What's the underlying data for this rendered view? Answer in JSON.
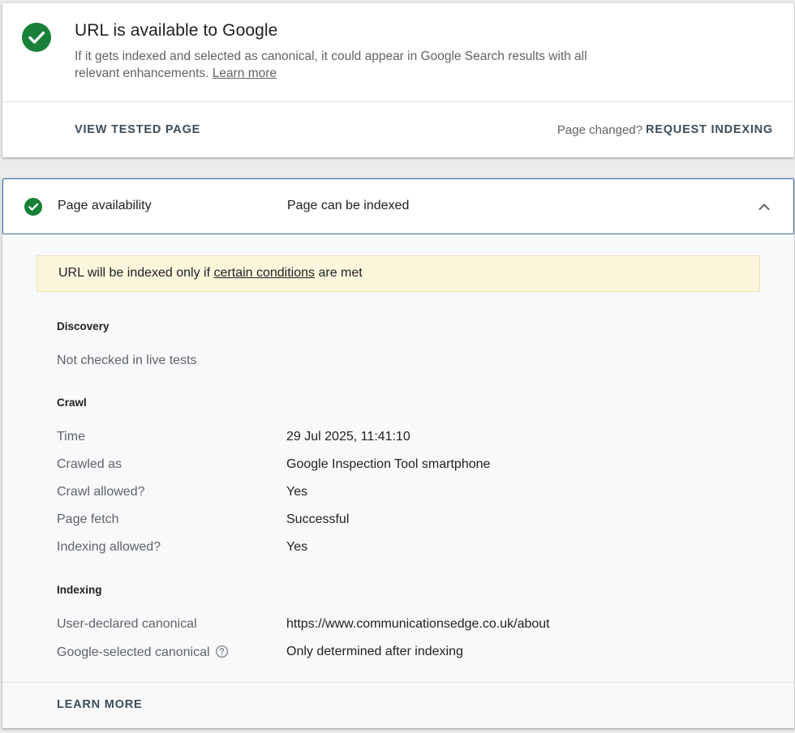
{
  "status_card": {
    "icon": "check-circle-icon",
    "title": "URL is available to Google",
    "description": "If it gets indexed and selected as canonical, it could appear in Google Search results with all relevant enhancements.",
    "learn_more_link": "Learn more",
    "view_tested_page": "VIEW TESTED PAGE",
    "page_changed": "Page changed?",
    "request_indexing": "REQUEST INDEXING"
  },
  "availability": {
    "icon": "check-circle-icon",
    "label": "Page availability",
    "value": "Page can be indexed",
    "expanded_icon": "chevron-up-icon",
    "notice": {
      "before": "URL will be indexed only if",
      "link": "certain conditions",
      "after": "are met"
    },
    "discovery": {
      "title": "Discovery",
      "text": "Not checked in live tests"
    },
    "crawl": {
      "title": "Crawl",
      "rows": [
        {
          "label": "Time",
          "value": "29 Jul 2025, 11:41:10"
        },
        {
          "label": "Crawled as",
          "value": "Google Inspection Tool smartphone"
        },
        {
          "label": "Crawl allowed?",
          "value": "Yes"
        },
        {
          "label": "Page fetch",
          "value": "Successful"
        },
        {
          "label": "Indexing allowed?",
          "value": "Yes"
        }
      ]
    },
    "indexing": {
      "title": "Indexing",
      "rows": [
        {
          "label": "User-declared canonical",
          "value": "https://www.communicationsedge.co.uk/about"
        },
        {
          "label": "Google-selected canonical",
          "value": "Only determined after indexing",
          "help_icon": "help-circle-icon"
        }
      ]
    },
    "learn_more": "LEARN MORE"
  },
  "colors": {
    "success_green": "#188038",
    "notice_bg": "#fdf6dd",
    "header_border": "#3c6aa8",
    "button_text": "#3c4d5c"
  }
}
